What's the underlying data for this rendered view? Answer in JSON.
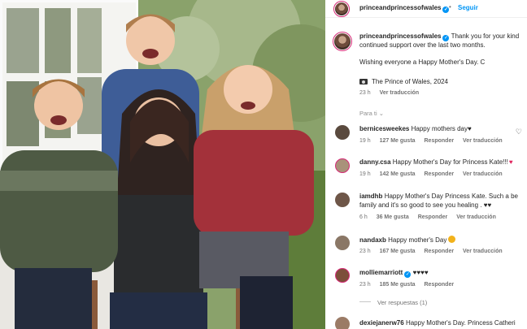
{
  "header": {
    "username": "princeandprincessofwales",
    "separator": "•",
    "follow_label": "Seguir"
  },
  "caption": {
    "username": "princeandprincessofwales",
    "line1": "Thank you for your kind",
    "line2": "continued support over the last two months.",
    "line3": "Wishing everyone a Happy Mother's Day. C",
    "credit": "The Prince of Wales, 2024",
    "time": "23 h",
    "translate": "Ver traducción"
  },
  "for_you_label": "Para ti",
  "comments": [
    {
      "username": "bernicesweekes",
      "text": "Happy mothers day",
      "emoji": "♥",
      "time": "19 h",
      "likes": "127 Me gusta",
      "reply": "Responder",
      "translate": "Ver traducción"
    },
    {
      "username": "danny.csa",
      "text": "Happy Mother's Day for Princess Kate!!!",
      "emoji": "♥",
      "time": "19 h",
      "likes": "142 Me gusta",
      "reply": "Responder",
      "translate": "Ver traducción"
    },
    {
      "username": "iamdhb",
      "text": "Happy Mother's Day Princess Kate. Such a be",
      "line2": "family and it's so good to see you healing . ♥♥",
      "time": "6 h",
      "likes": "36 Me gusta",
      "reply": "Responder",
      "translate": "Ver traducción"
    },
    {
      "username": "nandaxb",
      "text": "Happy mother's Day",
      "time": "23 h",
      "likes": "167 Me gusta",
      "reply": "Responder",
      "translate": "Ver traducción"
    },
    {
      "username": "molliemarriott",
      "text": "♥♥♥♥",
      "time": "23 h",
      "likes": "185 Me gusta",
      "reply": "Responder"
    },
    {
      "username": "dexiejanerw76",
      "text": "Happy Mother's Day. Princess Catheri"
    }
  ],
  "view_replies": "Ver respuestas (1)",
  "colors": {
    "accent": "#0095f6",
    "ring": "#d62976",
    "muted": "#737373"
  },
  "icons": [
    "verified-badge-icon",
    "camera-icon",
    "heart-icon",
    "chevron-down-icon"
  ]
}
